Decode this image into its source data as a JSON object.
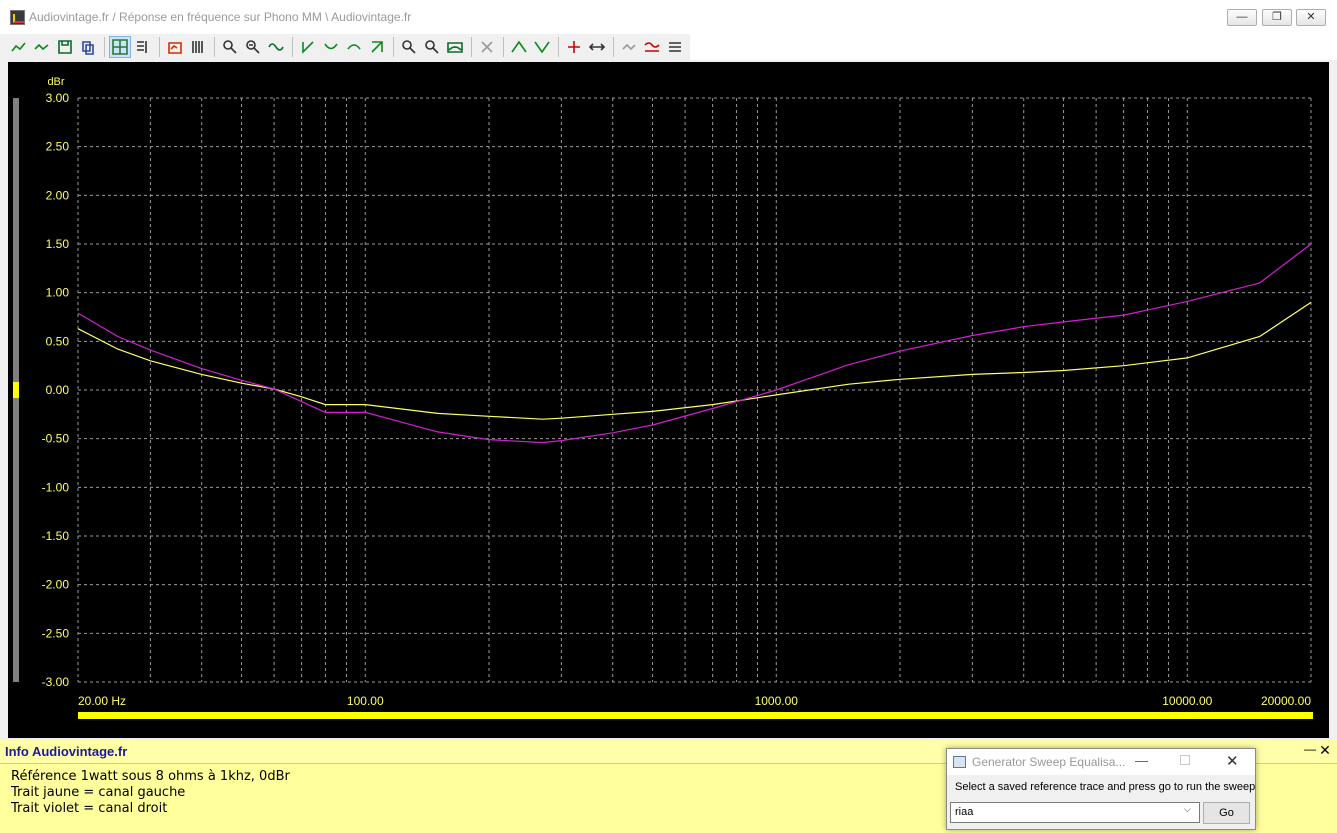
{
  "window": {
    "title": "Audiovintage.fr   /   Réponse en fréquence sur Phono MM   \\   Audiovintage.fr",
    "buttons": {
      "minimize": "—",
      "restore": "❐",
      "close": "✕"
    }
  },
  "toolbar": {
    "icons": [
      "trace-add-icon",
      "trace-remove-icon",
      "save-icon",
      "copy-icon",
      "grid-toggle-icon",
      "legend-icon",
      "measure-icon",
      "marker-icon",
      "zoom-in-icon",
      "zoom-out-icon",
      "fit-icon",
      "cursor-left-icon",
      "cursor-right-icon",
      "cursor-up-icon",
      "cursor-down-icon",
      "find-min-icon",
      "find-max-icon",
      "auto-scale-icon",
      "disabled-tool-icon",
      "peak-icon",
      "trough-icon",
      "add-marker-icon",
      "move-marker-icon",
      "history-icon",
      "compare-icon",
      "settings-icon"
    ]
  },
  "chart_data": {
    "type": "line",
    "xscale": "log",
    "ylabel": "dBr",
    "xlim": [
      20,
      20000
    ],
    "ylim": [
      -3.0,
      3.0
    ],
    "yticks": [
      "3.00",
      "2.50",
      "2.00",
      "1.50",
      "1.00",
      "0.50",
      "0.00",
      "-0.50",
      "-1.00",
      "-1.50",
      "-2.00",
      "-2.50",
      "-3.00"
    ],
    "xtick_labels": [
      {
        "value": 20,
        "label": "20.00 Hz"
      },
      {
        "value": 100,
        "label": "100.00"
      },
      {
        "value": 1000,
        "label": "1000.00"
      },
      {
        "value": 10000,
        "label": "10000.00"
      },
      {
        "value": 20000,
        "label": "20000.00"
      }
    ],
    "grid": true,
    "series": [
      {
        "color": "#ffff66",
        "x": [
          20,
          25,
          30,
          40,
          50,
          60,
          70,
          80,
          100,
          150,
          200,
          270,
          300,
          400,
          500,
          700,
          1000,
          1500,
          2000,
          3000,
          4000,
          5000,
          7000,
          10000,
          15000,
          20000
        ],
        "y": [
          0.63,
          0.42,
          0.3,
          0.16,
          0.07,
          0.01,
          -0.07,
          -0.15,
          -0.15,
          -0.24,
          -0.27,
          -0.3,
          -0.29,
          -0.25,
          -0.22,
          -0.15,
          -0.05,
          0.06,
          0.11,
          0.16,
          0.18,
          0.2,
          0.25,
          0.33,
          0.55,
          0.9
        ]
      },
      {
        "color": "#d020d0",
        "x": [
          20,
          25,
          30,
          40,
          50,
          60,
          70,
          80,
          100,
          150,
          200,
          270,
          300,
          400,
          500,
          700,
          1000,
          1500,
          2000,
          3000,
          4000,
          5000,
          7000,
          10000,
          15000,
          20000
        ],
        "y": [
          0.79,
          0.55,
          0.41,
          0.22,
          0.1,
          0.01,
          -0.12,
          -0.23,
          -0.23,
          -0.43,
          -0.51,
          -0.54,
          -0.52,
          -0.44,
          -0.36,
          -0.19,
          0.0,
          0.26,
          0.4,
          0.56,
          0.65,
          0.7,
          0.77,
          0.91,
          1.1,
          1.5
        ]
      }
    ]
  },
  "info": {
    "title": "Info Audiovintage.fr",
    "lines": [
      "Référence 1watt sous 8 ohms à 1khz, 0dBr",
      "Trait jaune = canal gauche",
      "Trait violet = canal droit"
    ],
    "minimize": "—",
    "close": "✕"
  },
  "generator": {
    "title": "Generator Sweep Equalisa...",
    "message": "Select a saved reference trace and press go to run the sweep",
    "selected": "riaa",
    "go_label": "Go",
    "min": "—",
    "close": "✕"
  }
}
